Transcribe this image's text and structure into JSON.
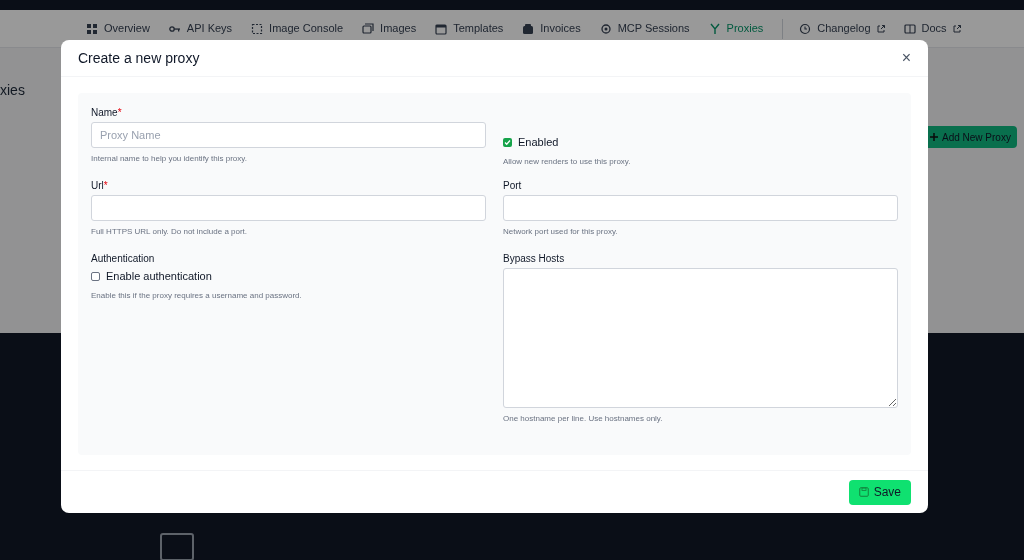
{
  "nav": {
    "items": [
      {
        "label": "Overview",
        "selected": false,
        "external": false,
        "divider_before": false
      },
      {
        "label": "API Keys",
        "selected": false,
        "external": false,
        "divider_before": false
      },
      {
        "label": "Image Console",
        "selected": false,
        "external": false,
        "divider_before": false
      },
      {
        "label": "Images",
        "selected": false,
        "external": false,
        "divider_before": false
      },
      {
        "label": "Templates",
        "selected": false,
        "external": false,
        "divider_before": false
      },
      {
        "label": "Invoices",
        "selected": false,
        "external": false,
        "divider_before": false
      },
      {
        "label": "MCP Sessions",
        "selected": false,
        "external": false,
        "divider_before": false
      },
      {
        "label": "Proxies",
        "selected": true,
        "external": false,
        "divider_before": false
      },
      {
        "label": "Changelog",
        "selected": false,
        "external": true,
        "divider_before": true
      },
      {
        "label": "Docs",
        "selected": false,
        "external": true,
        "divider_before": false
      }
    ]
  },
  "page": {
    "title": "xies",
    "add_button": "Add New Proxy"
  },
  "modal": {
    "title": "Create a new proxy",
    "close": "×",
    "left": [
      {
        "kind": "text",
        "label": "Name",
        "required_mark": "*",
        "placeholder": "Proxy Name",
        "help": "Internal name to help you identify this proxy."
      },
      {
        "kind": "text",
        "label": "Url",
        "required_mark": "*",
        "help": "Full HTTPS URL only. Do not include a port."
      },
      {
        "kind": "checkbox",
        "heading": "Authentication",
        "label": "Enable authentication",
        "checked": false,
        "help": "Enable this if the proxy requires a username and password."
      }
    ],
    "right": [
      {
        "kind": "checkbox",
        "label": "Enabled",
        "checked": true,
        "help": "Allow new renders to use this proxy."
      },
      {
        "kind": "text",
        "label": "Port",
        "help": "Network port used for this proxy."
      },
      {
        "kind": "textarea",
        "label": "Bypass Hosts",
        "help": "One hostname per line. Use hostnames only."
      }
    ],
    "save_button": "Save"
  }
}
